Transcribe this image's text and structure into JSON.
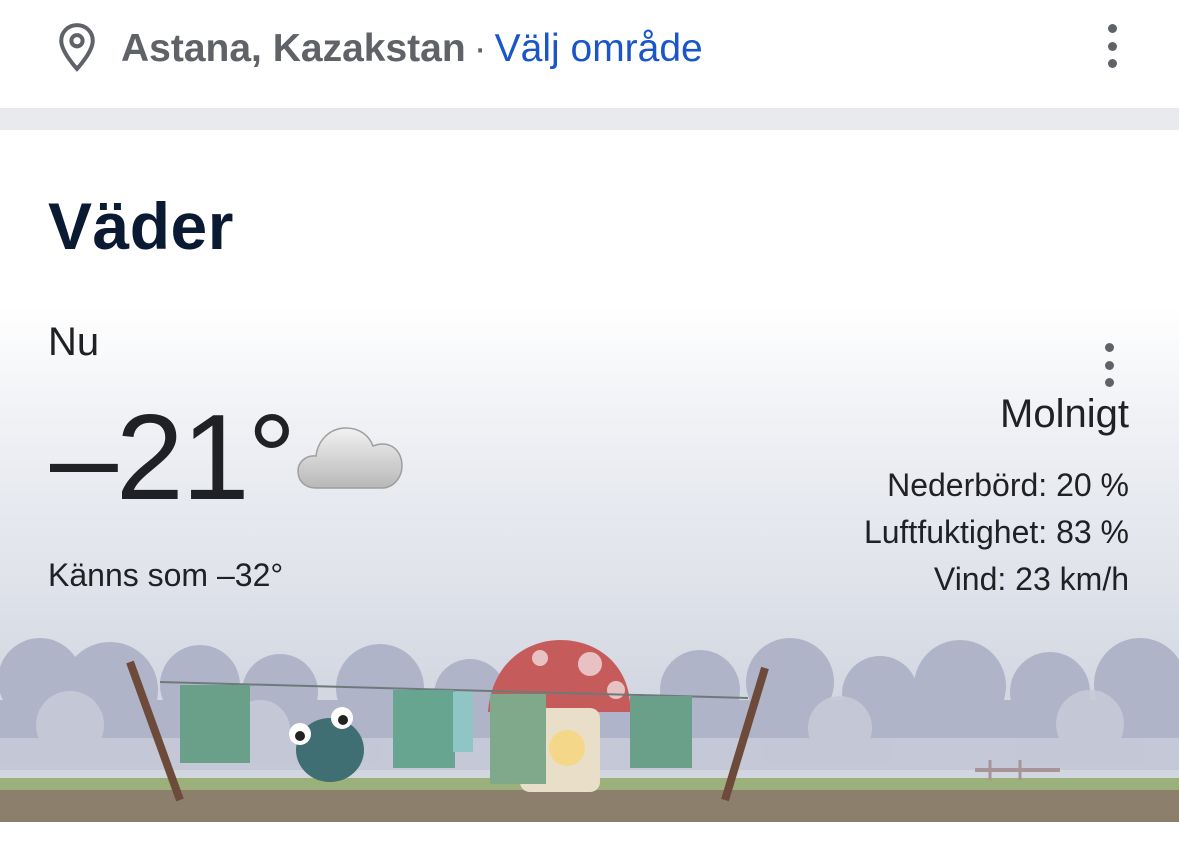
{
  "location": {
    "city": "Astana, Kazakstan",
    "separator": "·",
    "change_link": "Välj område"
  },
  "weather": {
    "title": "Väder",
    "now_label": "Nu",
    "temperature": "–21°",
    "feels_like": "Känns som –32°",
    "condition": "Molnigt",
    "details": {
      "precipitation": "Nederbörd: 20 %",
      "humidity": "Luftfuktighet: 83 %",
      "wind": "Vind: 23 km/h"
    }
  },
  "icons": {
    "location": "location-pin-icon",
    "more": "more-vert-icon",
    "condition": "cloud-icon"
  },
  "colors": {
    "link": "#1a56c8",
    "title": "#0b1a33",
    "muted": "#5f6368"
  }
}
